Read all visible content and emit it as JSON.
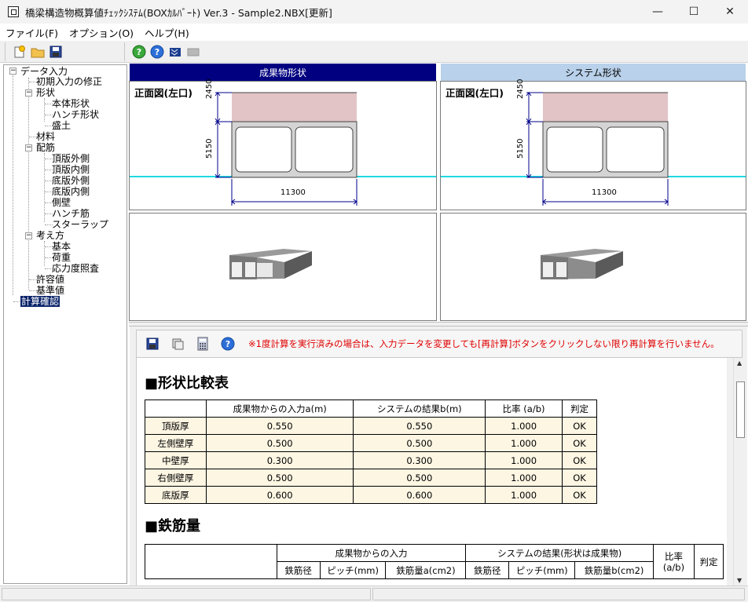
{
  "window": {
    "title": "橋梁構造物概算値ﾁｪｯｸｼｽﾃﾑ(BOXｶﾙﾊﾞｰﾄ) Ver.3 - Sample2.NBX[更新]",
    "min": "—",
    "max": "☐",
    "close": "✕"
  },
  "menu": [
    "ファイル(F)",
    "オプション(O)",
    "ヘルプ(H)"
  ],
  "tree": {
    "root": "データ入力",
    "init": "初期入力の修正",
    "shape": "形状",
    "shape_items": [
      "本体形状",
      "ハンチ形状",
      "盛土"
    ],
    "material": "材料",
    "rebar": "配筋",
    "rebar_items": [
      "頂版外側",
      "頂版内側",
      "底版外側",
      "底版内側",
      "側壁",
      "ハンチ筋",
      "スターラップ"
    ],
    "concept": "考え方",
    "concept_items": [
      "基本",
      "荷重",
      "応力度照査"
    ],
    "allow": "許容値",
    "base": "基準値",
    "calc": "計算確認"
  },
  "panels": {
    "left_header": "成果物形状",
    "right_header": "システム形状",
    "view_title": "正面図(左口)",
    "dim_top": "2450",
    "dim_mid": "5150",
    "dim_width": "11300"
  },
  "lower": {
    "warning": "※1度計算を実行済みの場合は、入力データを変更しても[再計算]ボタンをクリックしない限り再計算を行いません。",
    "section1": "■形状比較表",
    "table1": {
      "headers": [
        "",
        "成果物からの入力a(m)",
        "システムの結果b(m)",
        "比率 (a/b)",
        "判定"
      ],
      "rows": [
        [
          "頂版厚",
          "0.550",
          "0.550",
          "1.000",
          "OK"
        ],
        [
          "左側壁厚",
          "0.500",
          "0.500",
          "1.000",
          "OK"
        ],
        [
          "中壁厚",
          "0.300",
          "0.300",
          "1.000",
          "OK"
        ],
        [
          "右側壁厚",
          "0.500",
          "0.500",
          "1.000",
          "OK"
        ],
        [
          "底版厚",
          "0.600",
          "0.600",
          "1.000",
          "OK"
        ]
      ]
    },
    "section2": "■鉄筋量",
    "table2": {
      "group1": "成果物からの入力",
      "group2": "システムの結果(形状は成果物)",
      "ratio": "比率\n(a/b)",
      "judge": "判定",
      "sub": [
        "鉄筋径",
        "ピッチ(mm)",
        "鉄筋量a(cm2)",
        "鉄筋径",
        "ピッチ(mm)",
        "鉄筋量b(cm2)"
      ]
    }
  },
  "colors": {
    "left_header_bg": "#000080",
    "right_header_bg": "#b9d1ea",
    "box_top_fill": "#e2c4c6",
    "water_line": "#20d8e0",
    "dim_color": "#00008b"
  }
}
